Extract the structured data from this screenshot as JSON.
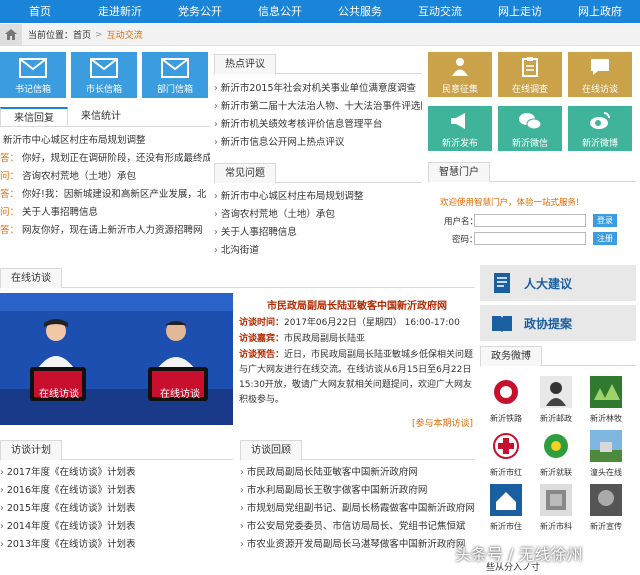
{
  "nav": [
    "首页",
    "走进新沂",
    "党务公开",
    "信息公开",
    "公共服务",
    "互动交流",
    "网上走访",
    "网上政府"
  ],
  "breadcrumb": {
    "label": "当前位置：",
    "home": "首页",
    "sep": ">",
    "current": "互动交流"
  },
  "mailboxes": [
    "书记信箱",
    "市长信箱",
    "部门信箱"
  ],
  "reply_tabs": [
    "来信回复",
    "来信统计"
  ],
  "reply_rows": [
    {
      "tag": "",
      "text": "新沂市中心城区村庄布局规划调整"
    },
    {
      "tag": "答：",
      "text": "你好，规划正在调研阶段，还没有形成最终成"
    },
    {
      "tag": "问：",
      "text": "咨询农村荒地（土地）承包"
    },
    {
      "tag": "答：",
      "text": "你好!我：因新城建设和高新区产业发展，北"
    },
    {
      "tag": "问：",
      "text": "关于人事招聘信息"
    },
    {
      "tag": "答：",
      "text": "网友你好，现在请上新沂市人力资源招聘网"
    }
  ],
  "hot_topics": {
    "title": "热点评议",
    "items": [
      "新沂市2015年社会对机关事业单位满意度调查",
      "新沂市第二届十大法治人物、十大法治事件评选网",
      "新沂市机关绩效考核评价信息管理平台",
      "新沂市信息公开网上热点评议"
    ]
  },
  "faq": {
    "title": "常见问题",
    "items": [
      "新沂市中心城区村庄布局规划调整",
      "咨询农村荒地（土地）承包",
      "关于人事招聘信息",
      "北沟街道"
    ]
  },
  "tiles": [
    "民意征集",
    "在线调查",
    "在线访谈",
    "新沂发布",
    "新沂微信",
    "新沂微博"
  ],
  "portal": {
    "title": "智慧门户",
    "welcome": "欢迎使用智慧门户，体验一站式服务!",
    "username_label": "用户名：",
    "password_label": "密码：",
    "login": "登录",
    "register": "注册"
  },
  "online_interview": {
    "section": "在线访谈",
    "title": "市民政局副局长陆亚敏客中国新沂政府网",
    "time_label": "访谈时间：",
    "time_value": "2017年06月22日（星期四） 16:00-17:00",
    "guest_label": "访谈嘉宾：",
    "guest_value": "市民政局副局长陆亚",
    "preview_label": "访谈预告：",
    "preview_value": "近日，市民政局副局长陆亚敏城乡低保相关问题与广大网友进行在线交流。在线访谈从6月15日至6月22日15:30开放，敬请广大网友就相关问题提问，欢迎广大网友积极参与。",
    "more": "[参与本期访谈]",
    "caption": "在线访谈"
  },
  "interview_plan": {
    "title": "访谈计划",
    "items": [
      "2017年度《在线访谈》计划表",
      "2016年度《在线访谈》计划表",
      "2015年度《在线访谈》计划表",
      "2014年度《在线访谈》计划表",
      "2013年度《在线访谈》计划表"
    ]
  },
  "interview_review": {
    "title": "访谈回顾",
    "items": [
      "市民政局副局长陆亚敏客中国新沂政府网",
      "市水利局副局长王敬宇做客中国新沂政府网",
      "市规划局党组副书记、副局长杨霞做客中国新沂政府网",
      "市公安局党委委员、市信访局局长、党组书记焦恒斌",
      "市农业资源开发局副局长马湛琴做客中国新沂政府网"
    ]
  },
  "side_buttons": [
    "人大建议",
    "政协提案"
  ],
  "gov_weibo": {
    "title": "政务微博",
    "items": [
      "新沂铁路",
      "新沂邮政",
      "新沂林牧",
      "新沂市红",
      "新沂就联",
      "潼头在线",
      "新沂市住",
      "新沂市科",
      "新沂宣传"
    ]
  },
  "footer_snippet": "些从分入ノ寸",
  "watermark": "头条号 / 无线徐州",
  "colors": {
    "nav_blue": "#1a84d8",
    "tile_gold": "#c9a24a",
    "tile_teal": "#3fb49a",
    "accent_orange": "#e06a00",
    "highlight_red": "#b22a00"
  }
}
